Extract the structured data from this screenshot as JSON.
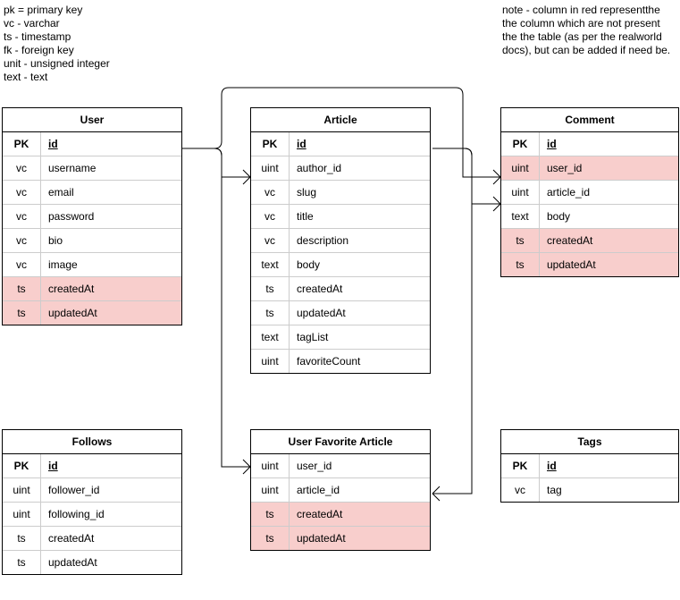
{
  "legend_left": {
    "l1": "pk = primary key",
    "l2": "vc - varchar",
    "l3": "ts - timestamp",
    "l4": "fk - foreign key",
    "l5": "unit - unsigned integer",
    "l6": "text - text"
  },
  "legend_right": {
    "l1": "note - column in red representthe",
    "l2": "the column which are not present",
    "l3": "the the table (as per the realworld",
    "l4": "docs), but can be added if need be."
  },
  "types": {
    "pk": "PK",
    "vc": "vc",
    "ts": "ts",
    "uint": "uint",
    "text": "text"
  },
  "entities": {
    "user": {
      "title": "User",
      "rows": [
        {
          "type": "pk",
          "name": "id",
          "pk": true
        },
        {
          "type": "vc",
          "name": "username"
        },
        {
          "type": "vc",
          "name": "email"
        },
        {
          "type": "vc",
          "name": "password"
        },
        {
          "type": "vc",
          "name": "bio"
        },
        {
          "type": "vc",
          "name": "image"
        },
        {
          "type": "ts",
          "name": "createdAt",
          "red": true
        },
        {
          "type": "ts",
          "name": "updatedAt",
          "red": true
        }
      ]
    },
    "article": {
      "title": "Article",
      "rows": [
        {
          "type": "pk",
          "name": "id",
          "pk": true
        },
        {
          "type": "uint",
          "name": "author_id"
        },
        {
          "type": "vc",
          "name": "slug"
        },
        {
          "type": "vc",
          "name": "title"
        },
        {
          "type": "vc",
          "name": "description"
        },
        {
          "type": "text",
          "name": "body"
        },
        {
          "type": "ts",
          "name": "createdAt"
        },
        {
          "type": "ts",
          "name": "updatedAt"
        },
        {
          "type": "text",
          "name": "tagList"
        },
        {
          "type": "uint",
          "name": "favoriteCount"
        }
      ]
    },
    "comment": {
      "title": "Comment",
      "rows": [
        {
          "type": "pk",
          "name": "id",
          "pk": true
        },
        {
          "type": "uint",
          "name": "user_id",
          "red": true
        },
        {
          "type": "uint",
          "name": "article_id"
        },
        {
          "type": "text",
          "name": "body"
        },
        {
          "type": "ts",
          "name": "createdAt",
          "red": true
        },
        {
          "type": "ts",
          "name": "updatedAt",
          "red": true
        }
      ]
    },
    "follows": {
      "title": "Follows",
      "rows": [
        {
          "type": "pk",
          "name": "id",
          "pk": true
        },
        {
          "type": "uint",
          "name": "follower_id"
        },
        {
          "type": "uint",
          "name": "following_id"
        },
        {
          "type": "ts",
          "name": "createdAt"
        },
        {
          "type": "ts",
          "name": "updatedAt"
        }
      ]
    },
    "ufa": {
      "title": "User Favorite Article",
      "rows": [
        {
          "type": "uint",
          "name": "user_id"
        },
        {
          "type": "uint",
          "name": "article_id"
        },
        {
          "type": "ts",
          "name": "createdAt",
          "red": true
        },
        {
          "type": "ts",
          "name": "updatedAt",
          "red": true
        }
      ]
    },
    "tags": {
      "title": "Tags",
      "rows": [
        {
          "type": "pk",
          "name": "id",
          "pk": true
        },
        {
          "type": "vc",
          "name": "tag"
        }
      ]
    }
  }
}
